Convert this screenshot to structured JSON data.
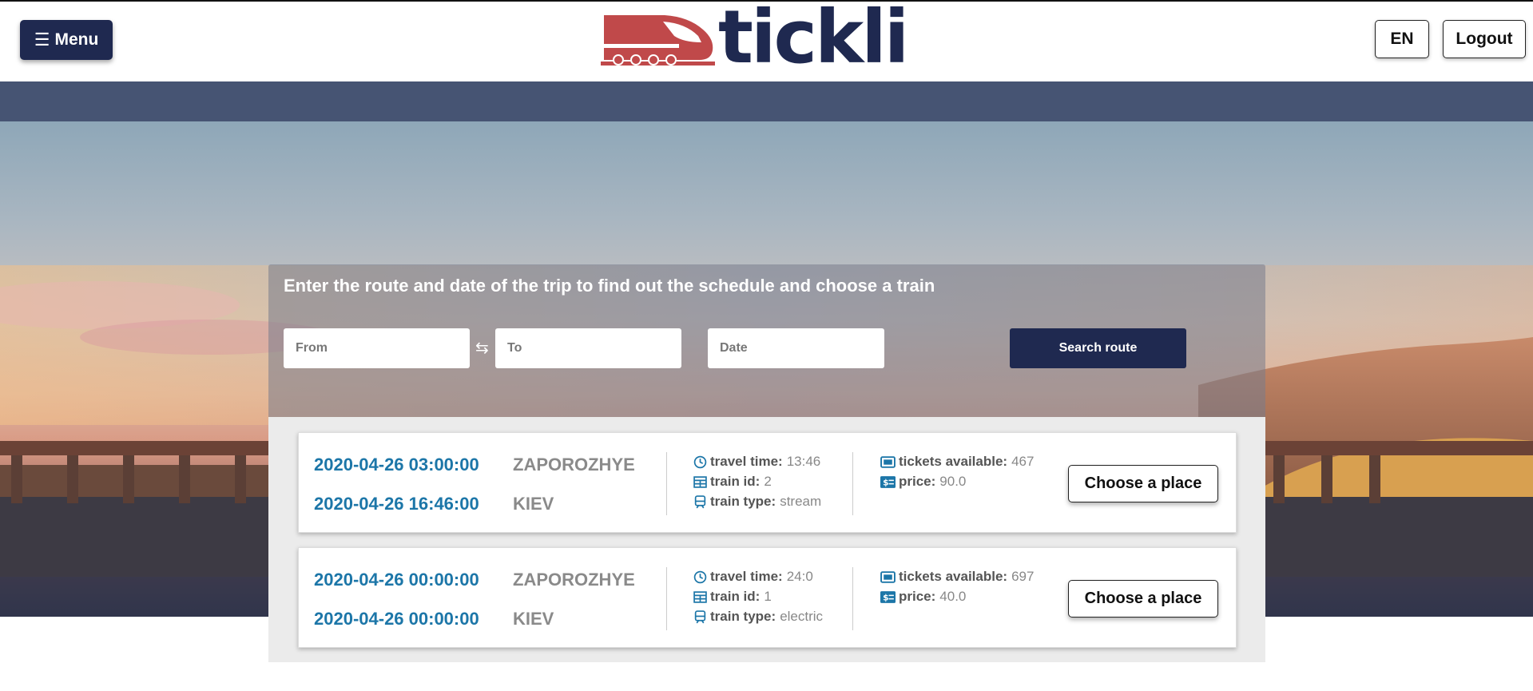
{
  "header": {
    "menu_label": "Menu",
    "logo_text": "tickli",
    "lang_label": "EN",
    "logout_label": "Logout"
  },
  "search": {
    "title": "Enter the route and date of the trip to find out the schedule and choose a train",
    "from_placeholder": "From",
    "to_placeholder": "To",
    "date_placeholder": "Date",
    "button_label": "Search route"
  },
  "labels": {
    "travel_time": "travel time:",
    "train_id": "train id:",
    "train_type": "train type:",
    "tickets_available": "tickets available:",
    "price": "price:",
    "choose": "Choose a place"
  },
  "results": [
    {
      "departure_time": "2020-04-26 03:00:00",
      "arrival_time": "2020-04-26 16:46:00",
      "from_station": "ZAPOROZHYE",
      "to_station": "KIEV",
      "travel_time": "13:46",
      "train_id": "2",
      "train_type": "stream",
      "tickets_available": "467",
      "price": "90.0"
    },
    {
      "departure_time": "2020-04-26 00:00:00",
      "arrival_time": "2020-04-26 00:00:00",
      "from_station": "ZAPOROZHYE",
      "to_station": "KIEV",
      "travel_time": "24:0",
      "train_id": "1",
      "train_type": "electric",
      "tickets_available": "697",
      "price": "40.0"
    }
  ],
  "colors": {
    "brand_navy": "#1f2950",
    "brand_red": "#c0494a",
    "subbar": "#465473",
    "accent_blue": "#1c76a8"
  }
}
